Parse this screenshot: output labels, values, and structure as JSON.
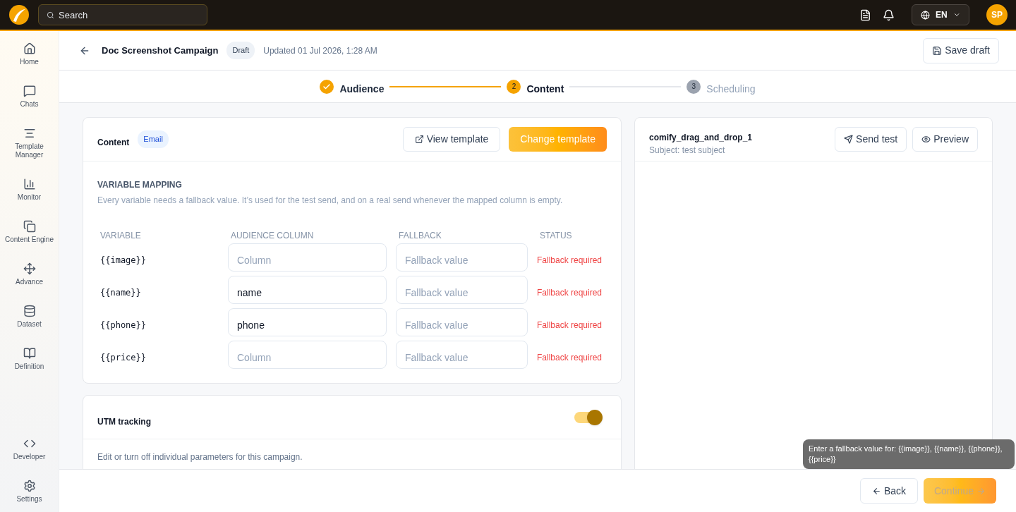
{
  "topbar": {
    "search": {
      "placeholder": "Search"
    },
    "language": "EN",
    "avatar": "SP"
  },
  "sidebar": {
    "items": [
      {
        "label": "Home"
      },
      {
        "label": "Chats"
      },
      {
        "label": "Template Manager"
      },
      {
        "label": "Monitor"
      },
      {
        "label": "Content Engine"
      },
      {
        "label": "Advance"
      },
      {
        "label": "Dataset"
      },
      {
        "label": "Definition"
      }
    ],
    "bottom_items": [
      {
        "label": "Developer"
      },
      {
        "label": "Settings"
      }
    ]
  },
  "header": {
    "title": "Doc Screenshot Campaign",
    "status": "Draft",
    "updated": "Updated 01 Jul 2026, 1:28 AM",
    "save_button": "Save draft"
  },
  "stepper": [
    {
      "label": "Audience",
      "completed": true,
      "selected": false
    },
    {
      "number": "2",
      "label": "Content",
      "completed": false,
      "selected": true
    },
    {
      "number": "3",
      "label": "Scheduling",
      "completed": false,
      "selected": false
    }
  ],
  "content_card": {
    "title": "Content",
    "channel": "Email",
    "view_button": "View template",
    "change_button": "Change template",
    "mapping": {
      "heading": "VARIABLE MAPPING",
      "description": "Every variable needs a fallback value. It’s used for the test send, and on a real send whenever the mapped column is empty.",
      "columns": [
        "VARIABLE",
        "AUDIENCE COLUMN",
        "FALLBACK",
        "STATUS"
      ],
      "rows": [
        {
          "variable": "{{image}}",
          "column": {
            "placeholder": "Column"
          },
          "fallback": {
            "placeholder": "Fallback value"
          },
          "status": "Fallback required"
        },
        {
          "variable": "{{name}}",
          "column": {
            "value": "name"
          },
          "fallback": {
            "placeholder": "Fallback value"
          },
          "status": "Fallback required"
        },
        {
          "variable": "{{phone}}",
          "column": {
            "value": "phone"
          },
          "fallback": {
            "placeholder": "Fallback value"
          },
          "status": "Fallback required"
        },
        {
          "variable": "{{price}}",
          "column": {
            "placeholder": "Column"
          },
          "fallback": {
            "placeholder": "Fallback value"
          },
          "status": "Fallback required"
        }
      ]
    }
  },
  "utm_card": {
    "title": "UTM tracking",
    "on": true,
    "description": "Edit or turn off individual parameters for this campaign."
  },
  "preview_card": {
    "template_name": "comify_drag_and_drop_1",
    "subject": "Subject: test subject",
    "send_test_button": "Send test",
    "preview_button": "Preview"
  },
  "tooltip": "Enter a fallback value for: {{image}}, {{name}}, {{phone}}, {{price}}",
  "footer": {
    "back_button": "Back",
    "continue_button": {
      "label": "Continue",
      "disabled": true
    }
  }
}
